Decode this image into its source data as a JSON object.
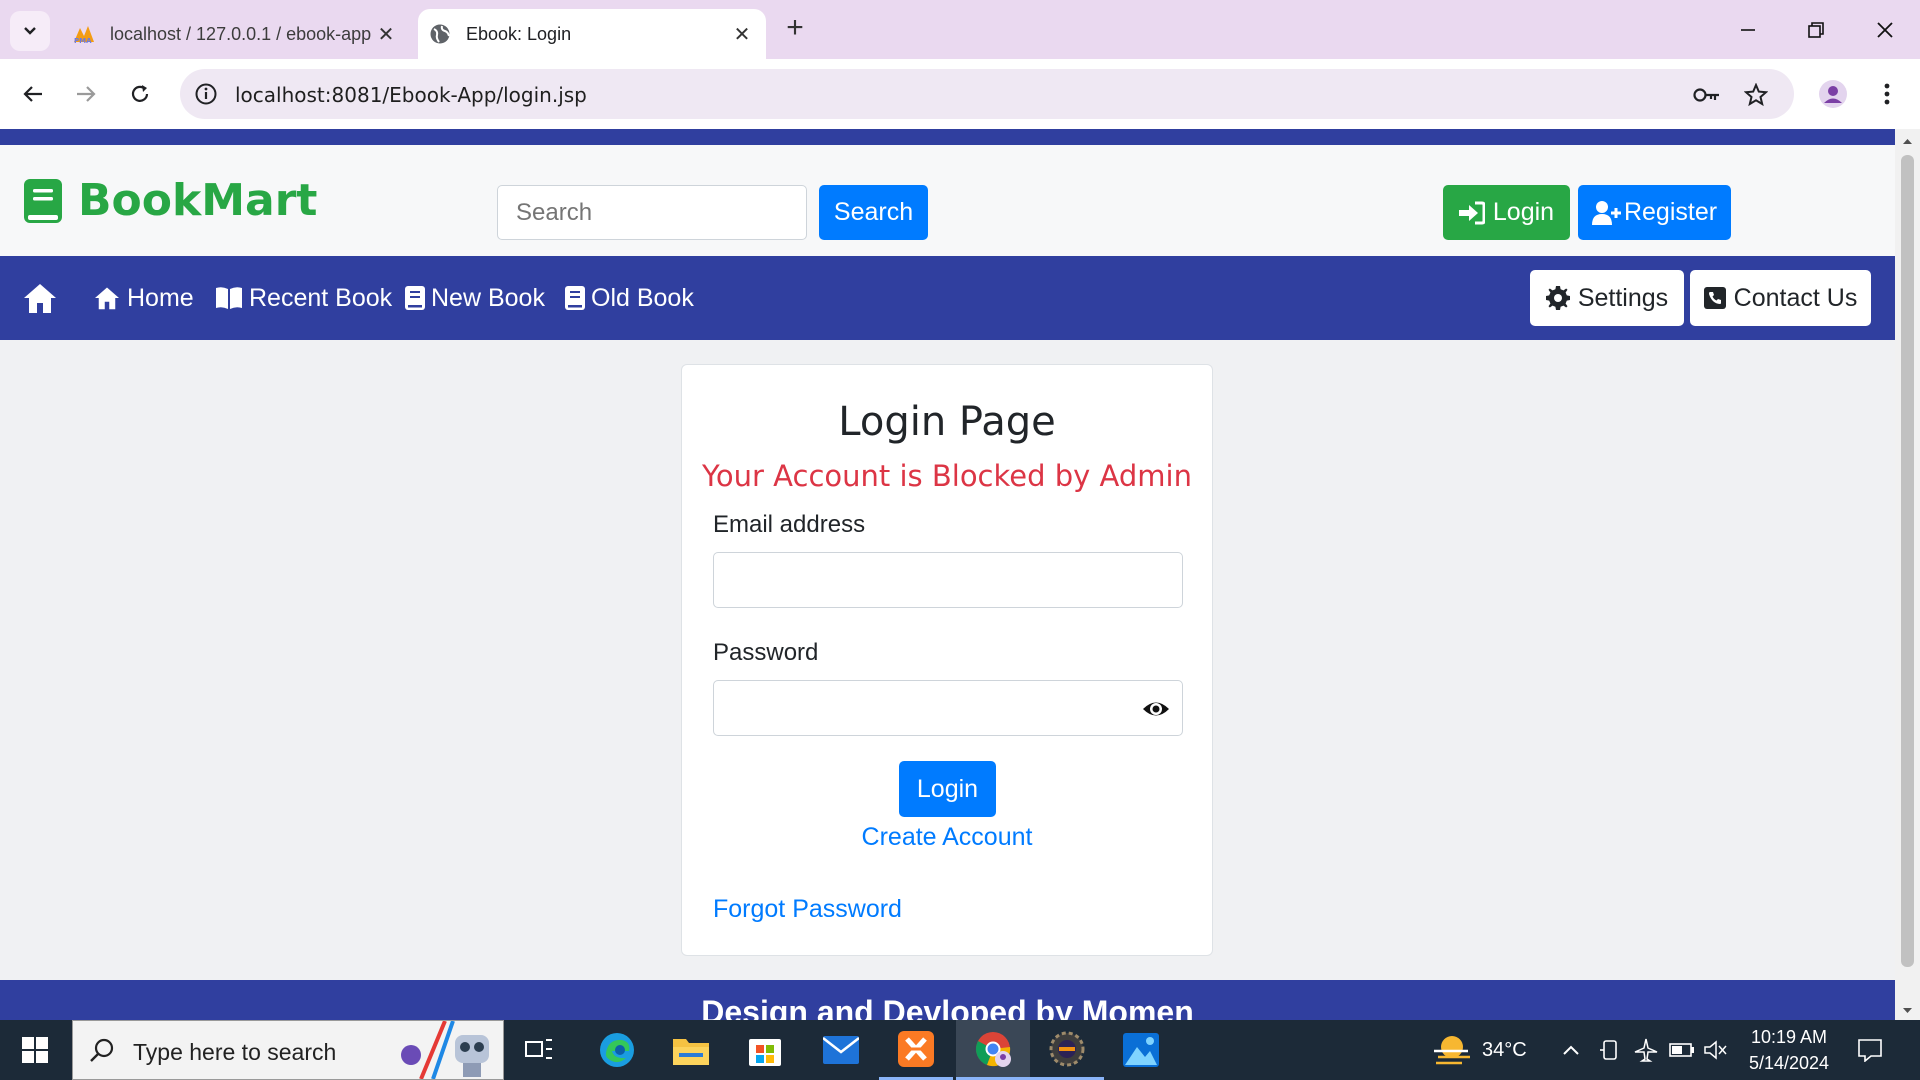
{
  "browser": {
    "tabs": [
      {
        "title": "localhost / 127.0.0.1 / ebook-app",
        "favicon": "phpmyadmin-icon"
      },
      {
        "title": "Ebook: Login",
        "favicon": "globe-icon",
        "active": true
      }
    ],
    "url": "localhost:8081/Ebook-App/login.jsp"
  },
  "site": {
    "brand": "BookMart",
    "search_placeholder": "Search",
    "search_button": "Search",
    "login_button": "Login",
    "register_button": "Register",
    "nav": {
      "items": [
        "Home",
        "Recent Book",
        "New Book",
        "Old Book"
      ],
      "settings": "Settings",
      "contact": "Contact Us"
    },
    "footer": "Design and Devloped by Momen"
  },
  "login_card": {
    "title": "Login Page",
    "error": "Your Account is Blocked by Admin",
    "email_label": "Email address",
    "email_value": "",
    "password_label": "Password",
    "password_value": "",
    "submit": "Login",
    "create_account": "Create Account",
    "forgot_password": "Forgot Password"
  },
  "taskbar": {
    "search_placeholder": "Type here to search",
    "weather": "34°C",
    "time": "10:19 AM",
    "date": "5/14/2024"
  },
  "colors": {
    "navy": "#303f9f",
    "green": "#28a745",
    "blue": "#007bff",
    "error_red": "#dc3545"
  }
}
